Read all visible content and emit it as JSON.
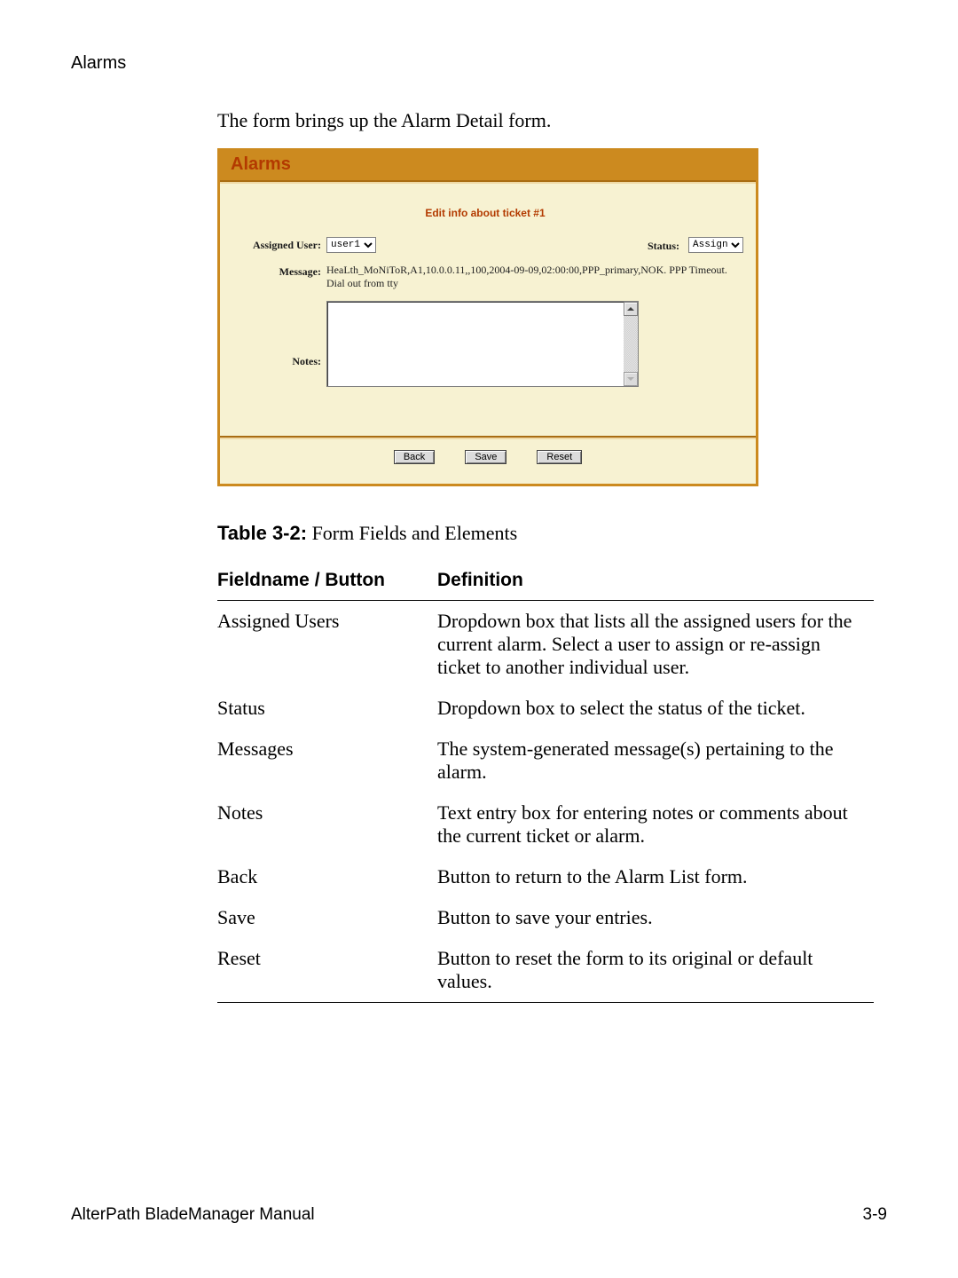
{
  "header": {
    "section": "Alarms"
  },
  "lead": "The form brings up the Alarm Detail form.",
  "panel": {
    "title": "Alarms",
    "edit_title": "Edit info about ticket #1",
    "labels": {
      "assigned_user": "Assigned User:",
      "status": "Status:",
      "message": "Message:",
      "notes": "Notes:"
    },
    "assigned_user_selected": "user1",
    "assigned_user_options": [
      "user1"
    ],
    "status_selected": "Assign",
    "status_options": [
      "Assign"
    ],
    "message_text": "HeaLth_MoNiToR,A1,10.0.0.11,,100,2004-09-09,02:00:00,PPP_primary,NOK. PPP Timeout. Dial out from tty",
    "notes_value": "",
    "buttons": {
      "back": "Back",
      "save": "Save",
      "reset": "Reset"
    }
  },
  "table": {
    "caption_bold": "Table 3-2:",
    "caption_rest": " Form Fields and Elements",
    "head": {
      "c1": "Fieldname / Button",
      "c2": "Definition"
    },
    "rows": [
      {
        "c1": "Assigned Users",
        "c2": "Dropdown box that lists all the assigned users for the current alarm. Select a user to assign or re-assign ticket to another individual user."
      },
      {
        "c1": "Status",
        "c2": "Dropdown box to select the status of the ticket."
      },
      {
        "c1": "Messages",
        "c2": "The system-generated message(s) pertaining to the alarm."
      },
      {
        "c1": "Notes",
        "c2": "Text entry box for entering notes or comments about the current ticket or alarm."
      },
      {
        "c1": "Back",
        "c2": "Button to return to the Alarm List form."
      },
      {
        "c1": "Save",
        "c2": "Button to save your entries."
      },
      {
        "c1": "Reset",
        "c2": "Button to reset the form to its original or default values."
      }
    ]
  },
  "footer": {
    "left": "AlterPath BladeManager Manual",
    "right": "3-9"
  }
}
